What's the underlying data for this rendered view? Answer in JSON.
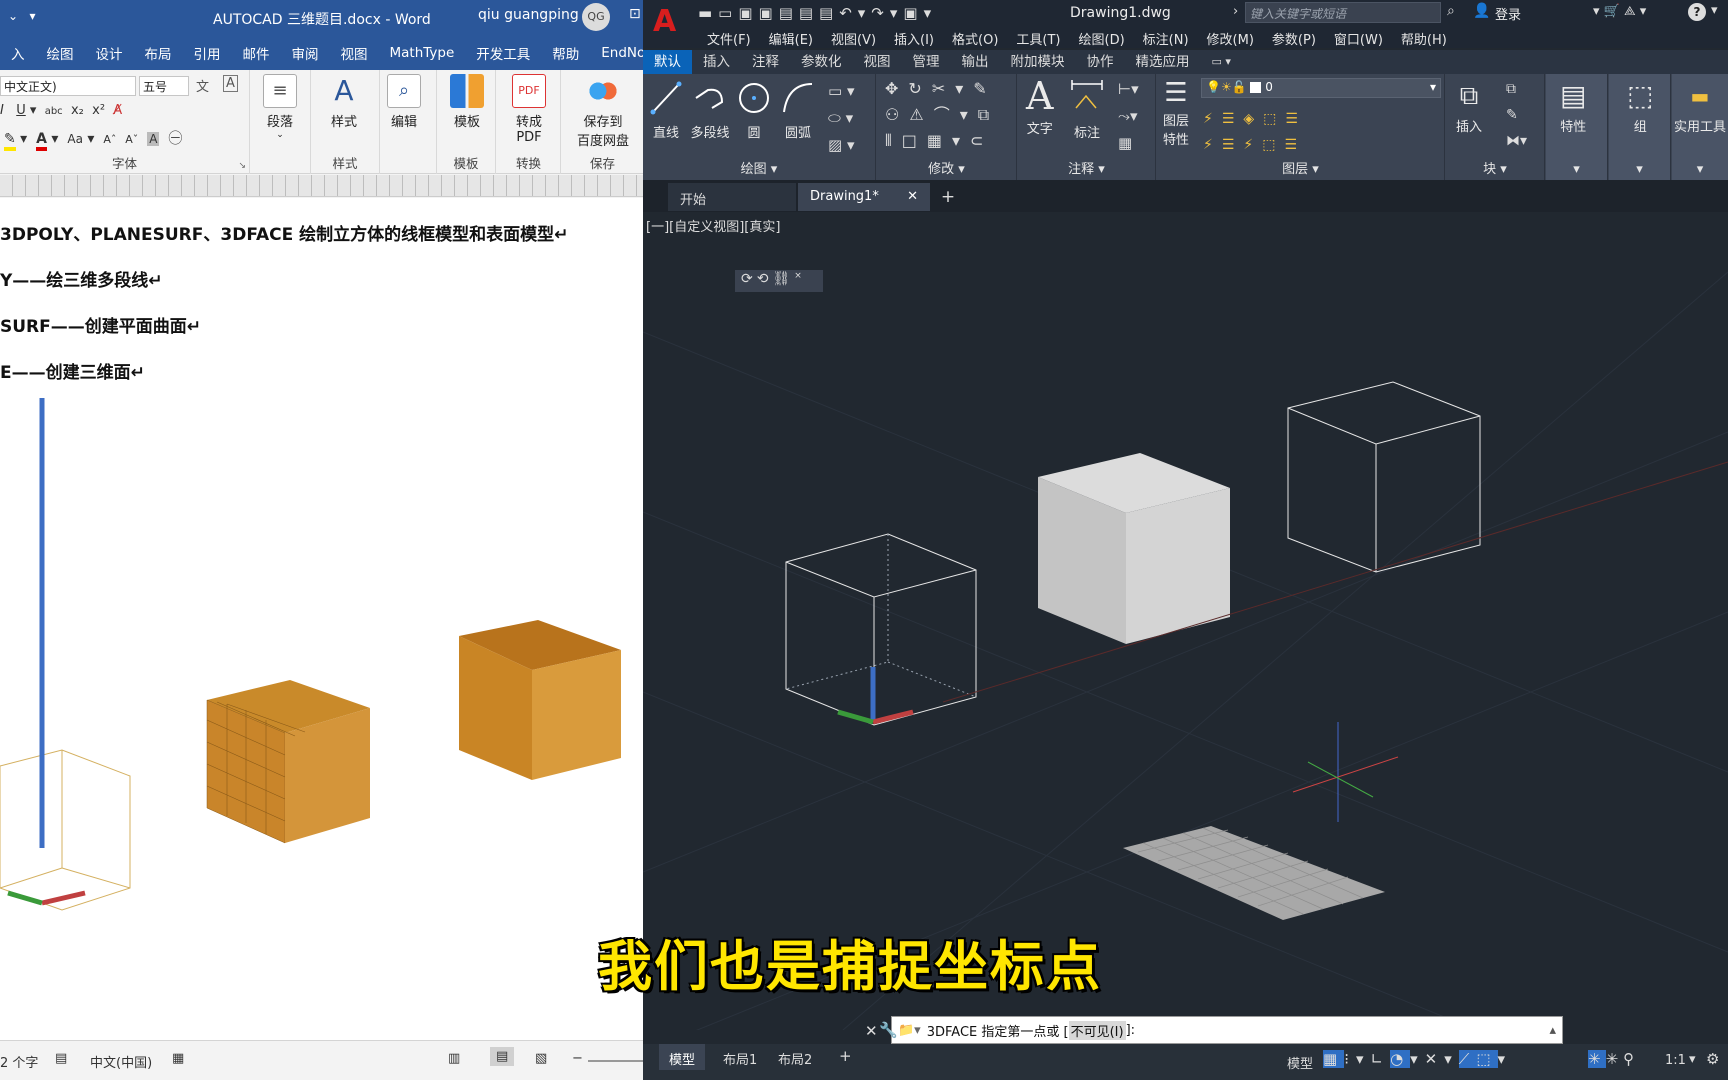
{
  "word": {
    "title": "AUTOCAD 三维题目.docx  -  Word",
    "user": "qiu guangping",
    "user_initials": "QG",
    "tabs": [
      "入",
      "绘图",
      "设计",
      "布局",
      "引用",
      "邮件",
      "审阅",
      "视图",
      "MathType",
      "开发工具",
      "帮助",
      "EndNote"
    ],
    "font_name": "中文正文)",
    "font_size": "五号",
    "groups": {
      "font": "字体",
      "styles": "样式",
      "templates": "模板",
      "convert": "转换",
      "save": "保存"
    },
    "buttons": {
      "paragraph": "段落",
      "styles": "样式",
      "edit": "编辑",
      "template": "模板",
      "to_pdf_1": "转成",
      "to_pdf_2": "PDF",
      "save_baidu_1": "保存到",
      "save_baidu_2": "百度网盘"
    },
    "doc_lines": [
      "3DPOLY、PLANESURF、3DFACE 绘制立方体的线框模型和表面模型↵",
      "Y——绘三维多段线↵",
      "SURF——创建平面曲面↵",
      "E——创建三维面↵"
    ],
    "status_words": "2 个字",
    "status_lang": "中文(中国)"
  },
  "cad": {
    "title": "Drawing1.dwg",
    "search_placeholder": "键入关键字或短语",
    "login": "登录",
    "menu": [
      "文件(F)",
      "编辑(E)",
      "视图(V)",
      "插入(I)",
      "格式(O)",
      "工具(T)",
      "绘图(D)",
      "标注(N)",
      "修改(M)",
      "参数(P)",
      "窗口(W)",
      "帮助(H)"
    ],
    "ribbon_tabs": [
      "默认",
      "插入",
      "注释",
      "参数化",
      "视图",
      "管理",
      "输出",
      "附加模块",
      "协作",
      "精选应用"
    ],
    "tools": {
      "line": "直线",
      "polyline": "多段线",
      "circle": "圆",
      "arc": "圆弧",
      "text": "文字",
      "dimension": "标注",
      "layer_props_1": "图层",
      "layer_props_2": "特性",
      "insert": "插入",
      "properties": "特性",
      "group": "组",
      "utilities": "实用工具"
    },
    "groups": {
      "draw": "绘图",
      "modify": "修改",
      "annotation": "注释",
      "layers": "图层",
      "block": "块"
    },
    "layer_name": "0",
    "doc_tabs": [
      "开始",
      "Drawing1*"
    ],
    "viewport_label": "[一][自定义视图][真实]",
    "command_prompt": "3DFACE 指定第一点或 [",
    "command_option": "不可见(I)",
    "command_end": "]:",
    "layout_tabs": [
      "模型",
      "布局1",
      "布局2"
    ],
    "status_model": "模型",
    "status_scale": "1:1"
  },
  "subtitle": "我们也是捕捉坐标点",
  "colors": {
    "word_blue": "#2b579a",
    "cad_dark": "#212830",
    "cube_orange": "#c68424",
    "subtitle": "#ffe600"
  }
}
